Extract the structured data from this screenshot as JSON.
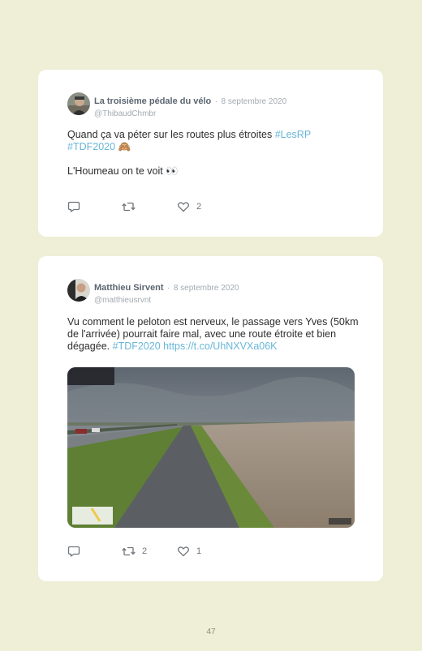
{
  "tweets": [
    {
      "name": "La troisième pédale du vélo",
      "separator": "·",
      "date": "8 septembre 2020",
      "handle": "@ThibaudChmbr",
      "text_line1": "Quand ça va péter sur les routes plus étroites ",
      "hashtag1": "#LesRP",
      "hashtag2": "#TDF2020",
      "emoji1": "🙈",
      "text_line2": "L'Houmeau on te voit ",
      "emoji2": "👀",
      "retweets": "",
      "likes": "2"
    },
    {
      "name": "Matthieu Sirvent",
      "separator": "·",
      "date": "8 septembre 2020",
      "handle": "@matthieusrvnt",
      "text": "Vu comment le peloton est nerveux, le passage vers Yves (50km de l'arrivée) pourrait faire mal, avec une route étroite et bien dégagée. ",
      "hashtag": "#TDF2020",
      "link": "https://t.co/UhNXVXa06K",
      "retweets": "2",
      "likes": "1"
    }
  ],
  "page_number": "47",
  "icons": {
    "reply": "reply-icon",
    "retweet": "retweet-icon",
    "like": "heart-icon"
  },
  "colors": {
    "background": "#efeed6",
    "card": "#ffffff",
    "link": "#68b6d8"
  }
}
